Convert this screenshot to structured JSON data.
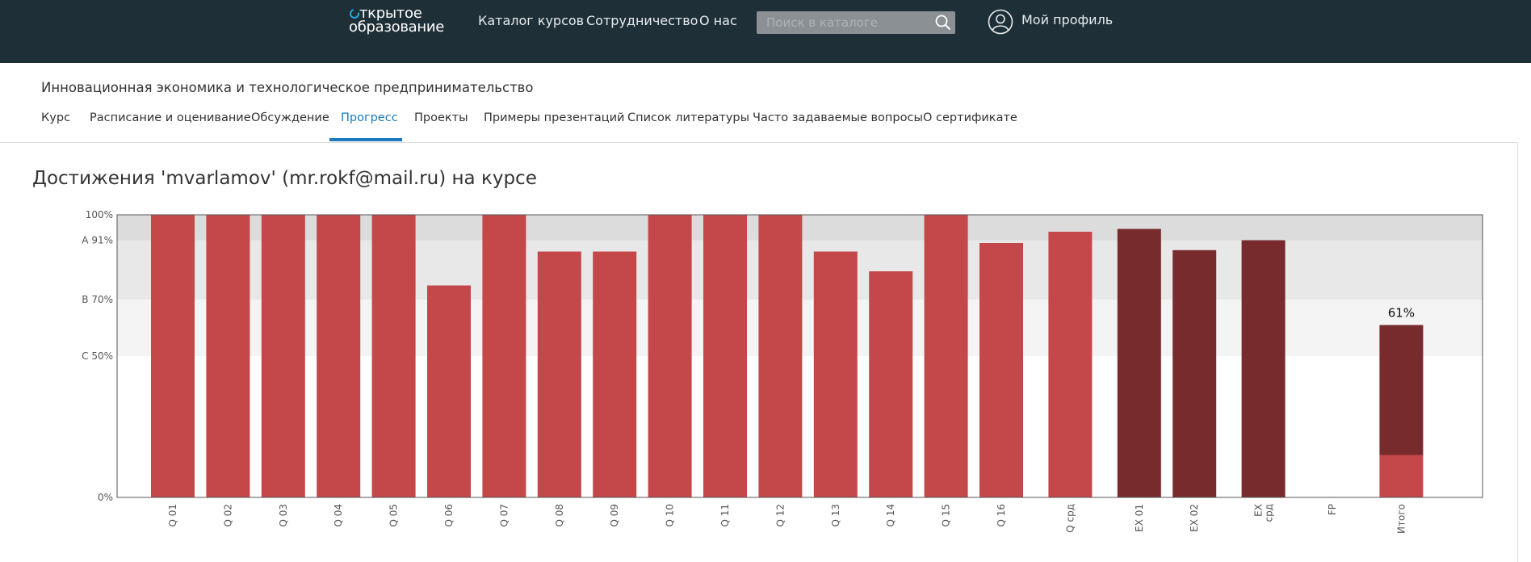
{
  "header": {
    "logo_line1": "ткрытое",
    "logo_line2": "образование",
    "nav": [
      "Каталог курсов",
      "Сотрудничество",
      "О нас"
    ],
    "search_placeholder": "Поиск в каталоге",
    "profile_label": "Мой профиль"
  },
  "course": {
    "title": "Инновационная экономика и технологическое предпринимательство",
    "tabs": [
      "Курс",
      "Расписание и оценивание",
      "Обсуждение",
      "Прогресс",
      "Проекты",
      "Примеры презентаций",
      "Список литературы",
      "Часто задаваемые вопросы",
      "О сертификате"
    ],
    "active_tab": "Прогресс"
  },
  "page_heading": "Достижения 'mvarlamov' (mr.rokf@mail.ru) на курсе",
  "colors": {
    "bar_light": "#c4484a",
    "bar_dark": "#782b2d",
    "band_a": "#dcdcdc",
    "band_b": "#e8e8e8",
    "band_c": "#f4f4f4",
    "accent": "#1b79bd",
    "header_bg": "#1f2f37"
  },
  "chart_data": {
    "type": "bar",
    "ylim": [
      0,
      100
    ],
    "y_ticks": [
      {
        "value": 100,
        "label": "100%"
      },
      {
        "value": 91,
        "label": "A 91%"
      },
      {
        "value": 70,
        "label": "B 70%"
      },
      {
        "value": 50,
        "label": "C 50%"
      },
      {
        "value": 0,
        "label": "0%"
      }
    ],
    "grade_bands": [
      {
        "from": 91,
        "to": 100,
        "color": "#dcdcdc"
      },
      {
        "from": 70,
        "to": 91,
        "color": "#e8e8e8"
      },
      {
        "from": 50,
        "to": 70,
        "color": "#f4f4f4"
      }
    ],
    "categories": [
      {
        "label": "Q 01",
        "value": 100,
        "kind": "light"
      },
      {
        "label": "Q 02",
        "value": 100,
        "kind": "light"
      },
      {
        "label": "Q 03",
        "value": 100,
        "kind": "light"
      },
      {
        "label": "Q 04",
        "value": 100,
        "kind": "light"
      },
      {
        "label": "Q 05",
        "value": 100,
        "kind": "light"
      },
      {
        "label": "Q 06",
        "value": 75,
        "kind": "light"
      },
      {
        "label": "Q 07",
        "value": 100,
        "kind": "light"
      },
      {
        "label": "Q 08",
        "value": 87,
        "kind": "light"
      },
      {
        "label": "Q 09",
        "value": 87,
        "kind": "light"
      },
      {
        "label": "Q 10",
        "value": 100,
        "kind": "light"
      },
      {
        "label": "Q 11",
        "value": 100,
        "kind": "light"
      },
      {
        "label": "Q 12",
        "value": 100,
        "kind": "light"
      },
      {
        "label": "Q 13",
        "value": 87,
        "kind": "light"
      },
      {
        "label": "Q 14",
        "value": 80,
        "kind": "light"
      },
      {
        "label": "Q 15",
        "value": 100,
        "kind": "light"
      },
      {
        "label": "Q 16",
        "value": 90,
        "kind": "light"
      },
      {
        "label": "Q срд",
        "value": 94,
        "kind": "light",
        "gap_before": true
      },
      {
        "label": "EX 01",
        "value": 95,
        "kind": "dark",
        "gap_before": true
      },
      {
        "label": "EX 02",
        "value": 87.5,
        "kind": "dark"
      },
      {
        "label": "EX срд",
        "value": 91,
        "kind": "dark",
        "gap_before": true
      },
      {
        "label": "FP",
        "value": 0,
        "kind": "light",
        "gap_before": true
      },
      {
        "label": "Итого",
        "value": 61,
        "kind": "total",
        "light_part": 15,
        "dark_part": 46,
        "data_label": "61%",
        "gap_before": true
      }
    ]
  }
}
